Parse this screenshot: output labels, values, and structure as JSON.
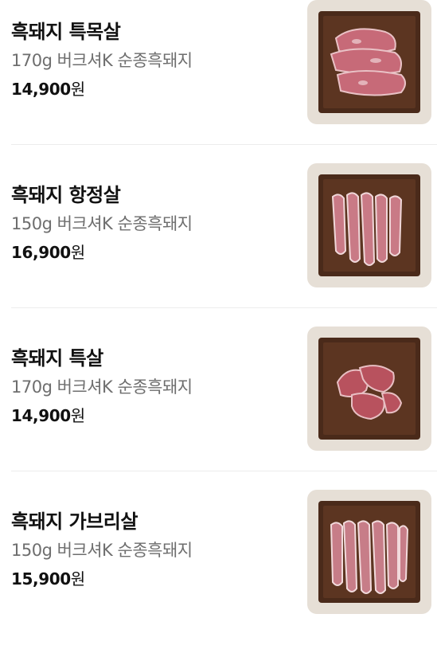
{
  "products": [
    {
      "name": "흑돼지 특목살",
      "desc": "170g 버크셔K 순종흑돼지",
      "price": "14,900",
      "unit": "원",
      "image": "pork-neck-photo"
    },
    {
      "name": "흑돼지 항정살",
      "desc": "150g 버크셔K 순종흑돼지",
      "price": "16,900",
      "unit": "원",
      "image": "pork-jowl-photo"
    },
    {
      "name": "흑돼지 특살",
      "desc": "170g 버크셔K 순종흑돼지",
      "price": "14,900",
      "unit": "원",
      "image": "pork-special-cut-photo"
    },
    {
      "name": "흑돼지 가브리살",
      "desc": "150g 버크셔K 순종흑돼지",
      "price": "15,900",
      "unit": "원",
      "image": "pork-shoulder-cap-photo"
    }
  ]
}
